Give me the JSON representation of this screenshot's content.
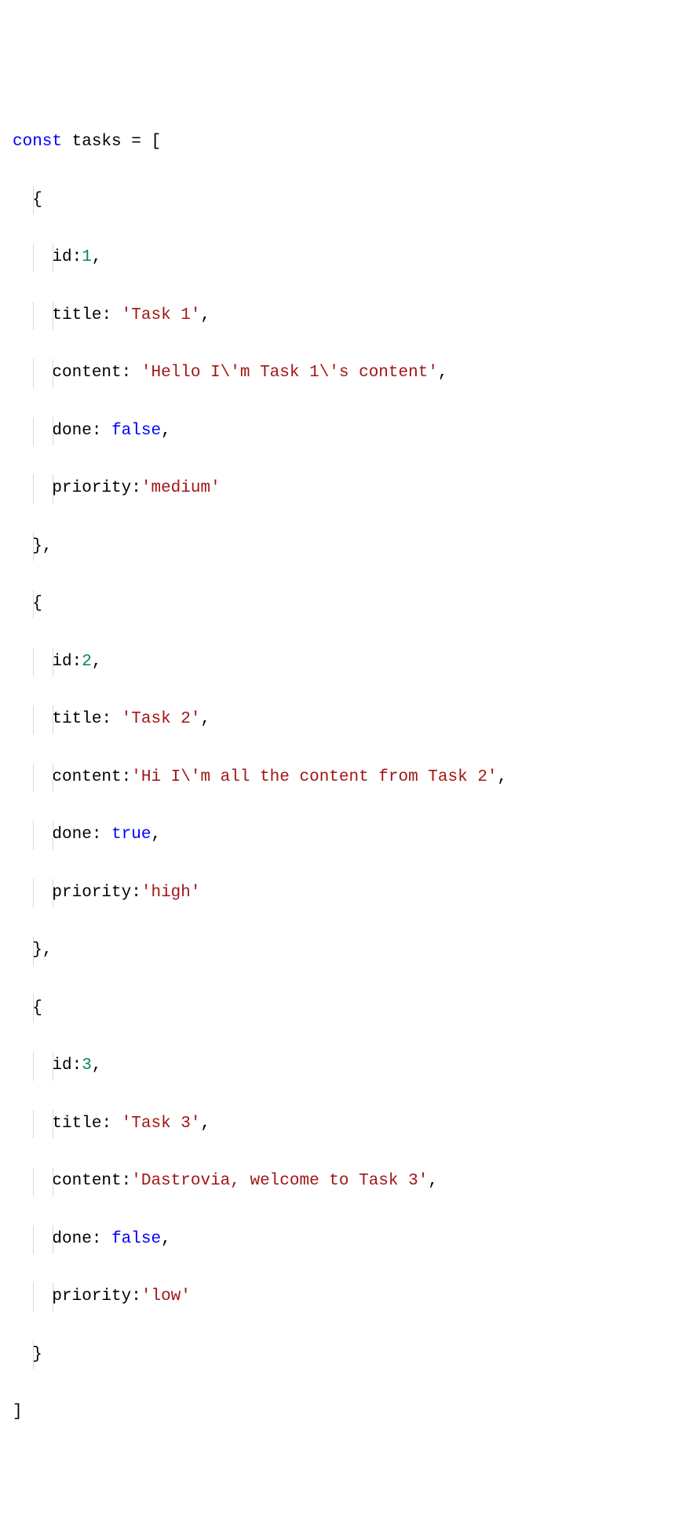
{
  "code": {
    "declaration": {
      "keyword": "const",
      "variable": "tasks",
      "equals": "=",
      "openBracket": "["
    },
    "tasks": [
      {
        "openBrace": "{",
        "props": {
          "id": {
            "key": "id",
            "colon": ":",
            "value": "1",
            "comma": ","
          },
          "title": {
            "key": "title",
            "colon": ":",
            "space": " ",
            "value": "'Task 1'",
            "comma": ","
          },
          "content": {
            "key": "content",
            "colon": ":",
            "space": " ",
            "value": "'Hello I\\'m Task 1\\'s content'",
            "comma": ","
          },
          "done": {
            "key": "done",
            "colon": ":",
            "space": " ",
            "value": "false",
            "comma": ","
          },
          "priority": {
            "key": "priority",
            "colon": ":",
            "space": "",
            "value": "'medium'",
            "comma": ""
          }
        },
        "closeBrace": "}",
        "trailingComma": ","
      },
      {
        "openBrace": "{",
        "props": {
          "id": {
            "key": "id",
            "colon": ":",
            "value": "2",
            "comma": ","
          },
          "title": {
            "key": "title",
            "colon": ":",
            "space": " ",
            "value": "'Task 2'",
            "comma": ","
          },
          "content": {
            "key": "content",
            "colon": ":",
            "space": "",
            "value": "'Hi I\\'m all the content from Task 2'",
            "comma": ","
          },
          "done": {
            "key": "done",
            "colon": ":",
            "space": " ",
            "value": "true",
            "comma": ","
          },
          "priority": {
            "key": "priority",
            "colon": ":",
            "space": "",
            "value": "'high'",
            "comma": ""
          }
        },
        "closeBrace": "}",
        "trailingComma": ","
      },
      {
        "openBrace": "{",
        "props": {
          "id": {
            "key": "id",
            "colon": ":",
            "value": "3",
            "comma": ","
          },
          "title": {
            "key": "title",
            "colon": ":",
            "space": " ",
            "value": "'Task 3'",
            "comma": ","
          },
          "content": {
            "key": "content",
            "colon": ":",
            "space": "",
            "value": "'Dastrovia, welcome to Task 3'",
            "comma": ","
          },
          "done": {
            "key": "done",
            "colon": ":",
            "space": " ",
            "value": "false",
            "comma": ","
          },
          "priority": {
            "key": "priority",
            "colon": ":",
            "space": "",
            "value": "'low'",
            "comma": ""
          }
        },
        "closeBrace": "}",
        "trailingComma": ""
      }
    ],
    "closeBracket": "]"
  },
  "indent": {
    "level1": "  ",
    "level2": "    "
  }
}
